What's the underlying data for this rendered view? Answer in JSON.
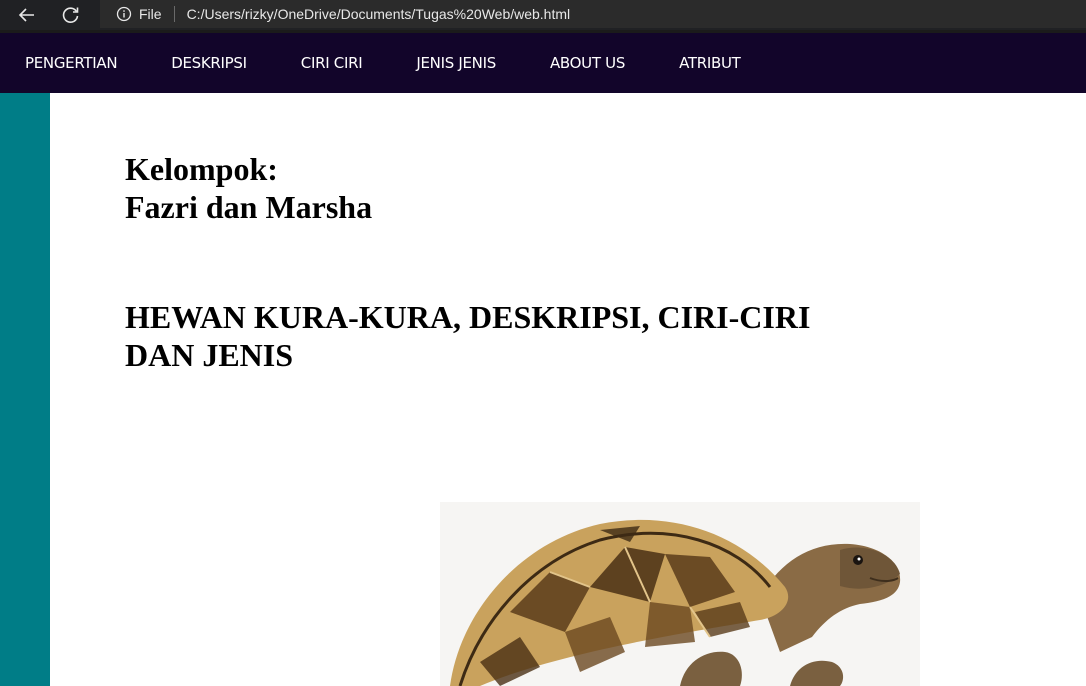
{
  "browser": {
    "file_label": "File",
    "url": "C:/Users/rizky/OneDrive/Documents/Tugas%20Web/web.html"
  },
  "nav": {
    "items": [
      "PENGERTIAN",
      "DESKRIPSI",
      "CIRI CIRI",
      "JENIS JENIS",
      "ABOUT US",
      "ATRIBUT"
    ]
  },
  "content": {
    "group_label": "Kelompok:",
    "group_members": "Fazri dan Marsha",
    "title_line1": "HEWAN KURA-KURA, DESKRIPSI, CIRI-CIRI",
    "title_line2": "DAN JENIS"
  },
  "colors": {
    "nav_bg": "#12052a",
    "side_strip": "#007d87",
    "browser_bg": "#202124"
  },
  "icons": {
    "back": "back-arrow-icon",
    "reload": "reload-icon",
    "info": "info-icon"
  }
}
